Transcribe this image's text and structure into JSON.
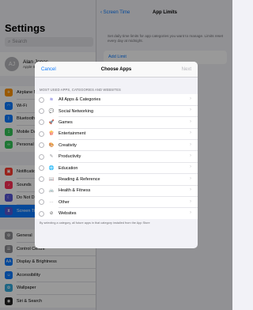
{
  "status": {
    "time": "10:00",
    "battery": "100%"
  },
  "sidebar": {
    "title": "Settings",
    "search_placeholder": "Search",
    "profile": {
      "initials": "AJ",
      "name": "Alan Jones",
      "sub": "Apple ID, iCloud, Media & Purchases"
    },
    "groups": [
      [
        {
          "label": "Airplane Mode",
          "icon": "airplane-icon",
          "color": "#ff9500",
          "glyph": "✈"
        },
        {
          "label": "Wi-Fi",
          "icon": "wifi-icon",
          "color": "#0a7aff",
          "glyph": "◠"
        },
        {
          "label": "Bluetooth",
          "icon": "bluetooth-icon",
          "color": "#0a7aff",
          "glyph": "ᛒ"
        },
        {
          "label": "Mobile Data",
          "icon": "antenna-icon",
          "color": "#34c759",
          "glyph": "⟟"
        },
        {
          "label": "Personal Hotspot",
          "icon": "hotspot-icon",
          "color": "#34c759",
          "glyph": "∞"
        }
      ],
      [
        {
          "label": "Notifications",
          "icon": "notifications-icon",
          "color": "#ff3b30",
          "glyph": "▣"
        },
        {
          "label": "Sounds",
          "icon": "speaker-icon",
          "color": "#ff2d55",
          "glyph": "♪"
        },
        {
          "label": "Do Not Disturb",
          "icon": "moon-icon",
          "color": "#5856d6",
          "glyph": "☾"
        },
        {
          "label": "Screen Time",
          "icon": "hourglass-icon",
          "color": "#5856d6",
          "glyph": "⧗",
          "selected": true
        }
      ],
      [
        {
          "label": "General",
          "icon": "gear-icon",
          "color": "#8e8e93",
          "glyph": "⚙"
        },
        {
          "label": "Control Centre",
          "icon": "control-centre-icon",
          "color": "#8e8e93",
          "glyph": "☰"
        },
        {
          "label": "Display & Brightness",
          "icon": "display-icon",
          "color": "#0a7aff",
          "glyph": "AA"
        },
        {
          "label": "Accessibility",
          "icon": "accessibility-icon",
          "color": "#0a7aff",
          "glyph": "☺"
        },
        {
          "label": "Wallpaper",
          "icon": "wallpaper-icon",
          "color": "#34aadc",
          "glyph": "✿"
        },
        {
          "label": "Siri & Search",
          "icon": "siri-icon",
          "color": "#222222",
          "glyph": "◉"
        }
      ]
    ]
  },
  "detail": {
    "back_label": "Screen Time",
    "title": "App Limits",
    "description": "Set daily time limits for app categories you want to manage. Limits reset every day at midnight.",
    "add_limit": "Add Limit"
  },
  "modal": {
    "cancel": "Cancel",
    "title": "Choose Apps",
    "next": "Next",
    "section": "MOST USED APPS, CATEGORIES AND WEBSITES",
    "rows": [
      {
        "label": "All Apps & Categories",
        "icon": "stack-icon",
        "glyph": "≋",
        "color": "#5856d6"
      },
      {
        "label": "Social Networking",
        "icon": "chat-bubble-icon",
        "glyph": "💬",
        "color": "#5ac8fa"
      },
      {
        "label": "Games",
        "icon": "rocket-icon",
        "glyph": "🚀",
        "color": "#5856d6"
      },
      {
        "label": "Entertainment",
        "icon": "popcorn-icon",
        "glyph": "🍿",
        "color": "#ff3b30"
      },
      {
        "label": "Creativity",
        "icon": "palette-icon",
        "glyph": "🎨",
        "color": "#ff9500"
      },
      {
        "label": "Productivity",
        "icon": "pencil-icon",
        "glyph": "✎",
        "color": "#8e8e93"
      },
      {
        "label": "Education",
        "icon": "globe-icon",
        "glyph": "🌐",
        "color": "#ff9500"
      },
      {
        "label": "Reading & Reference",
        "icon": "book-icon",
        "glyph": "📖",
        "color": "#8e8e93"
      },
      {
        "label": "Health & Fitness",
        "icon": "bicycle-icon",
        "glyph": "🚲",
        "color": "#34aadc"
      },
      {
        "label": "Other",
        "icon": "dots-icon",
        "glyph": "···",
        "color": "#8e8e93"
      },
      {
        "label": "Websites",
        "icon": "compass-icon",
        "glyph": "⊘",
        "color": "#555555"
      }
    ],
    "footer": "By selecting a category, all future apps in that category installed from the App Store"
  }
}
